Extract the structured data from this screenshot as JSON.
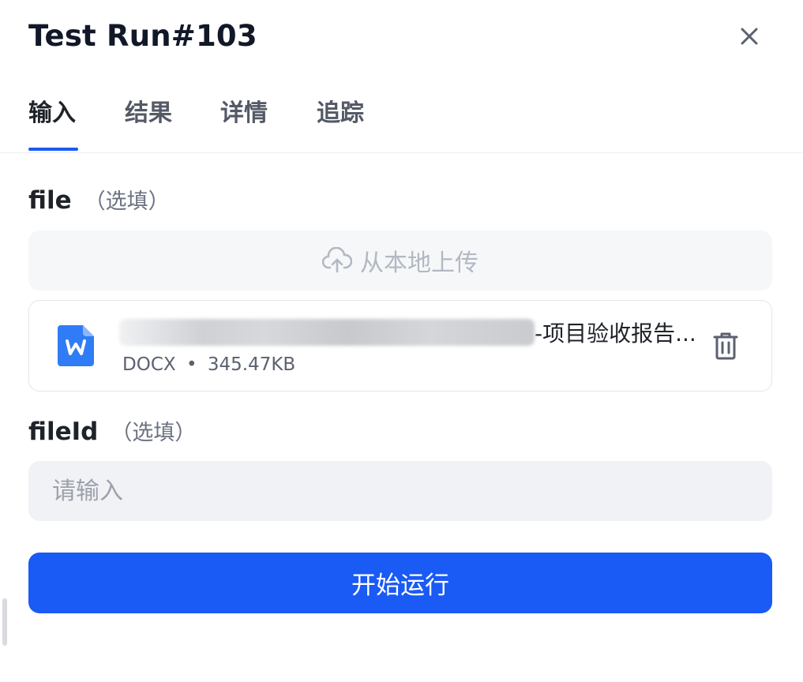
{
  "header": {
    "title": "Test Run#103",
    "close_icon": "close-icon"
  },
  "tabs": [
    {
      "label": "输入",
      "active": true
    },
    {
      "label": "结果",
      "active": false
    },
    {
      "label": "详情",
      "active": false
    },
    {
      "label": "追踪",
      "active": false
    }
  ],
  "fields": {
    "file": {
      "label": "file",
      "optional": "（选填）",
      "upload_label": "从本地上传",
      "upload_icon": "cloud-upload-icon",
      "attachment": {
        "icon": "word-file-icon",
        "name_visible": "-项目验收报告...",
        "type": "DOCX",
        "separator": "•",
        "size": "345.47KB",
        "delete_icon": "trash-icon"
      }
    },
    "fileId": {
      "label": "fileId",
      "optional": "（选填）",
      "placeholder": "请输入",
      "value": ""
    }
  },
  "actions": {
    "run_label": "开始运行"
  },
  "colors": {
    "accent": "#1a5af5",
    "word_blue": "#2f7cf6"
  }
}
